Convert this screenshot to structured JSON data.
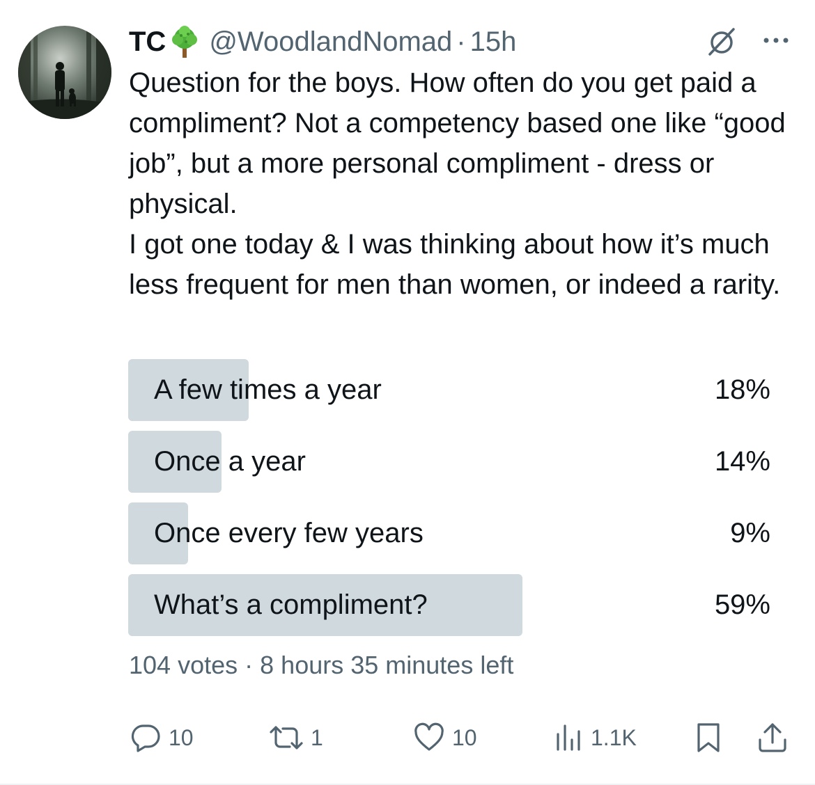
{
  "tweet": {
    "display_name": "TC",
    "name_badge_icon": "tree-emoji-icon",
    "handle": "@WoodlandNomad",
    "separator": "·",
    "time": "15h",
    "text_paragraphs": [
      "Question for the boys. How often do you get paid a compliment? Not a competency based one like “good job”, but a more personal compliment - dress or physical.",
      "I got one today & I was thinking about how it’s much less frequent for men than women, or indeed a rarity."
    ]
  },
  "poll": {
    "options": [
      {
        "label": "A few times a year",
        "percent_text": "18%",
        "percent": 18,
        "winner": false
      },
      {
        "label": "Once a year",
        "percent_text": "14%",
        "percent": 14,
        "winner": false
      },
      {
        "label": "Once every few years",
        "percent_text": "9%",
        "percent": 9,
        "winner": false
      },
      {
        "label": "What’s a compliment?",
        "percent_text": "59%",
        "percent": 59,
        "winner": true
      }
    ],
    "votes": "104 votes",
    "separator": "·",
    "time_left": "8 hours 35 minutes left"
  },
  "actions": {
    "reply_count": "10",
    "retweet_count": "1",
    "like_count": "10",
    "views_count": "1.1K"
  },
  "icons": {
    "grok": "grok-icon",
    "more": "more-options-icon",
    "reply": "reply-icon",
    "retweet": "retweet-icon",
    "like": "heart-icon",
    "views": "views-icon",
    "bookmark": "bookmark-icon",
    "share": "share-icon"
  },
  "colors": {
    "text": "#0f1419",
    "secondary": "#536471",
    "poll_bar": "#cfd9de"
  }
}
